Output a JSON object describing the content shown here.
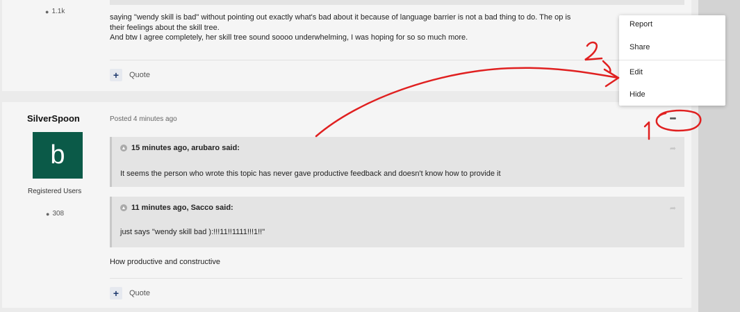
{
  "top_post": {
    "rep_count": "1.1k",
    "lines": [
      "saying \"wendy skill is bad\" without pointing out exactly what's bad about it because of language barrier is not a bad thing to do. The op is",
      "their feelings about the skill tree.",
      "And btw I agree completely, her skill tree sound soooo underwhelming, I was hoping for so so much more."
    ],
    "quote_label": "Quote"
  },
  "main_post": {
    "author": "SilverSpoon",
    "avatar_letter": "b",
    "role": "Registered Users",
    "rep_count": "308",
    "posted": "Posted 4 minutes ago",
    "quotes": [
      {
        "header": "15 minutes ago, arubaro said:",
        "body": "It seems the person who wrote this topic has never gave productive feedback and doesn't know how to provide it"
      },
      {
        "header": "11 minutes ago, Sacco said:",
        "body": "just says \"wendy skill bad ):!!!11!!1111!!!1!!\""
      }
    ],
    "body": "How productive and constructive",
    "quote_label": "Quote",
    "more_button": "•••"
  },
  "menu": {
    "items": [
      "Report",
      "Share",
      "Edit",
      "Hide"
    ]
  },
  "annotations": {
    "label_1": "1",
    "label_2": "2",
    "color": "#e02020"
  },
  "colors": {
    "avatar_bg": "#0b5a48",
    "quote_plus": "#1f3a6e"
  }
}
